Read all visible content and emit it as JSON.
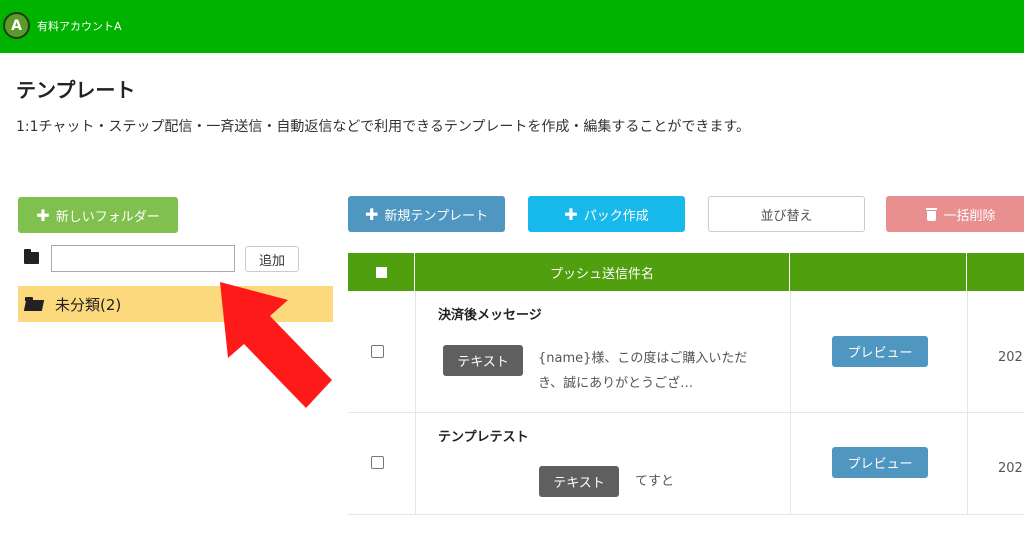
{
  "header": {
    "avatar_letter": "A",
    "account_name": "有料アカウントA",
    "bar_color": "#00b300"
  },
  "page": {
    "title": "テンプレート",
    "description": "1:1チャット・ステップ配信・一斉送信・自動返信などで利用できるテンプレートを作成・編集することができます。"
  },
  "folders": {
    "new_folder_label": "新しいフォルダー",
    "input_value": "",
    "add_label": "追加",
    "items": [
      {
        "label": "未分類(2)",
        "selected": true
      }
    ]
  },
  "toolbar": {
    "new_template_label": "新規テンプレート",
    "pack_create_label": "パック作成",
    "sort_label": "並び替え",
    "bulk_delete_label": "一括削除"
  },
  "table": {
    "headers": {
      "name": "プッシュ送信件名",
      "date": ""
    },
    "header_color": "#4f9f0f",
    "rows": [
      {
        "title": "決済後メッセージ",
        "type": "テキスト",
        "message_line1": "{name}様、この度はご購入いただ",
        "message_line2": "き、誠にありがとうござ…",
        "preview_label": "プレビュー",
        "date": "202"
      },
      {
        "title": "テンプレテスト",
        "type": "テキスト",
        "message_line1": "てすと",
        "preview_label": "プレビュー",
        "date": "202"
      }
    ]
  },
  "annotation": {
    "arrow_color": "#ff1a1a",
    "icon": "red-arrow-icon"
  }
}
